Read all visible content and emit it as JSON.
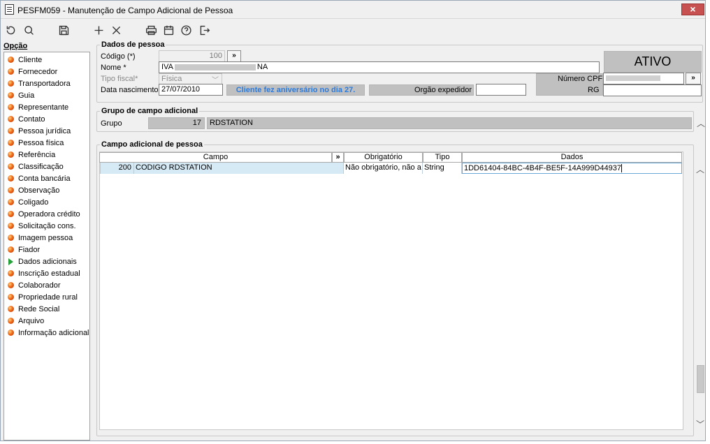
{
  "window": {
    "title": "PESFM059 - Manutenção de Campo Adicional de Pessoa",
    "close_label": "×"
  },
  "toolbar": {
    "icons": [
      "refresh-icon",
      "search-icon",
      "save-icon",
      "add-icon",
      "delete-icon",
      "print-icon",
      "calendar-icon",
      "help-icon",
      "exit-icon"
    ]
  },
  "sidebar": {
    "heading": "Opção",
    "items": [
      {
        "label": "Cliente",
        "icon": "bullet"
      },
      {
        "label": "Fornecedor",
        "icon": "bullet"
      },
      {
        "label": "Transportadora",
        "icon": "bullet"
      },
      {
        "label": "Guia",
        "icon": "bullet"
      },
      {
        "label": "Representante",
        "icon": "bullet"
      },
      {
        "label": "Contato",
        "icon": "bullet"
      },
      {
        "label": "Pessoa jurídica",
        "icon": "bullet"
      },
      {
        "label": "Pessoa física",
        "icon": "bullet"
      },
      {
        "label": "Referência",
        "icon": "bullet"
      },
      {
        "label": "Classificação",
        "icon": "bullet"
      },
      {
        "label": "Conta bancária",
        "icon": "bullet"
      },
      {
        "label": "Observação",
        "icon": "bullet"
      },
      {
        "label": "Coligado",
        "icon": "bullet"
      },
      {
        "label": "Operadora crédito",
        "icon": "bullet"
      },
      {
        "label": "Solicitação cons.",
        "icon": "bullet"
      },
      {
        "label": "Imagem pessoa",
        "icon": "bullet"
      },
      {
        "label": "Fiador",
        "icon": "bullet"
      },
      {
        "label": "Dados adicionais",
        "icon": "arrow"
      },
      {
        "label": "Inscrição estadual",
        "icon": "bullet"
      },
      {
        "label": "Colaborador",
        "icon": "bullet"
      },
      {
        "label": "Propriedade rural",
        "icon": "bullet"
      },
      {
        "label": "Rede Social",
        "icon": "bullet"
      },
      {
        "label": "Arquivo",
        "icon": "bullet"
      },
      {
        "label": "Informação adicional",
        "icon": "bullet"
      }
    ]
  },
  "pessoa": {
    "group_label": "Dados de pessoa",
    "codigo_label": "Código (*)",
    "codigo_value": "100",
    "nome_label": "Nome *",
    "nome_value_start": "IVA",
    "nome_value_end": "NA",
    "tipo_fiscal_label": "Tipo fiscal*",
    "tipo_fiscal_value": "Física",
    "data_nascimento_label": "Data nascimento",
    "data_nascimento_value": "27/07/2010",
    "aniversario_text": "Cliente fez aniversário no dia 27.",
    "orgao_label": "Orgão expedidor",
    "orgao_value": "",
    "status": "ATIVO",
    "cpf_label": "Número CPF",
    "rg_label": "RG",
    "rg_value": "",
    "lookup_label": "»"
  },
  "grupo": {
    "group_label": "Grupo de campo adicional",
    "grupo_label": "Grupo",
    "grupo_code": "17",
    "grupo_name": "RDSTATION"
  },
  "campo": {
    "group_label": "Campo adicional de pessoa",
    "columns": [
      "Campo",
      "Obrigatório",
      "Tipo",
      "Dados"
    ],
    "expand_label": "»",
    "rows": [
      {
        "code": "200",
        "campo": "CODIGO RDSTATION",
        "obrigatorio": "Não obrigatório, não a",
        "tipo": "String",
        "dados": "1DD61404-84BC-4B4F-BE5F-14A999D44937"
      }
    ]
  }
}
